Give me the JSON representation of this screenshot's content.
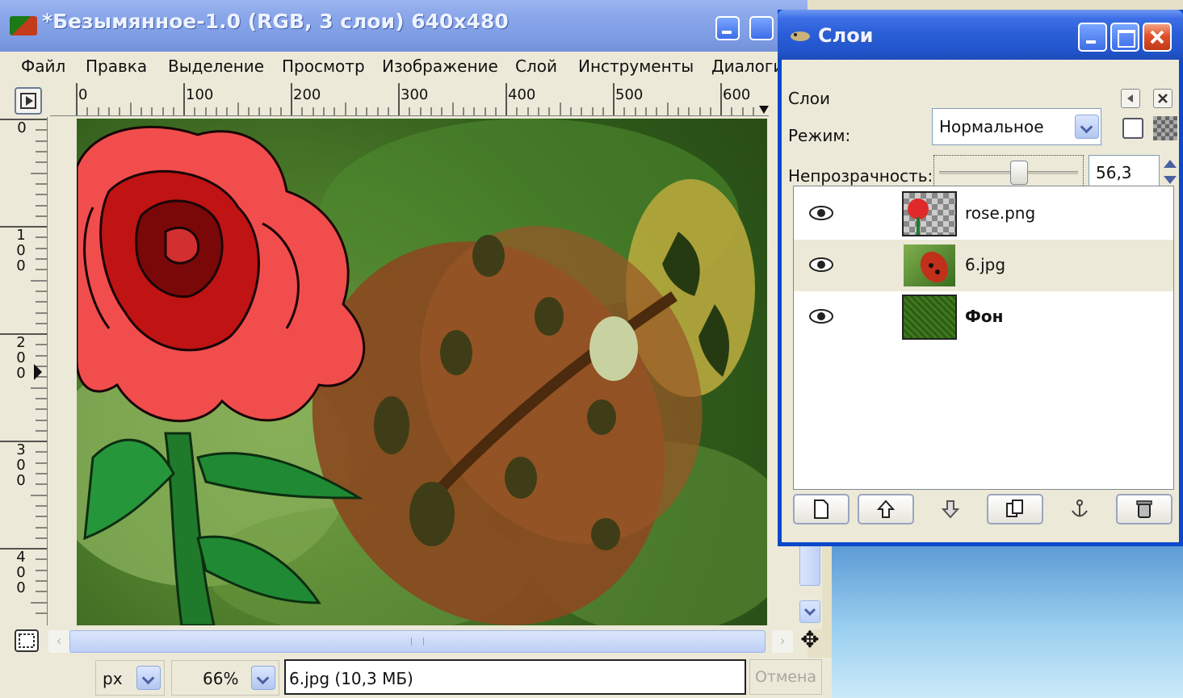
{
  "image_window": {
    "title": "*Безымянное-1.0 (RGB, 3 слои) 640x480",
    "menu": [
      "Файл",
      "Правка",
      "Выделение",
      "Просмотр",
      "Изображение",
      "Слой",
      "Инструменты",
      "Диалоги"
    ],
    "ruler_h_labels": [
      "0",
      "100",
      "200",
      "300",
      "400",
      "500",
      "600"
    ],
    "ruler_v_labels": [
      "0",
      "100",
      "200",
      "300",
      "400"
    ],
    "status": {
      "unit": "px",
      "zoom": "66%",
      "layer_info": "6.jpg (10,3 МБ)",
      "cancel": "Отмена"
    }
  },
  "layers_dock": {
    "title": "Слои",
    "tab_label": "Слои",
    "mode_label": "Режим:",
    "mode_value": "Нормальное",
    "opacity_label": "Непрозрачность:",
    "opacity_value": "56,3",
    "layers": [
      {
        "name": "rose.png",
        "bold": false,
        "selected": false
      },
      {
        "name": "6.jpg",
        "bold": false,
        "selected": true
      },
      {
        "name": "Фон",
        "bold": true,
        "selected": false
      }
    ]
  }
}
